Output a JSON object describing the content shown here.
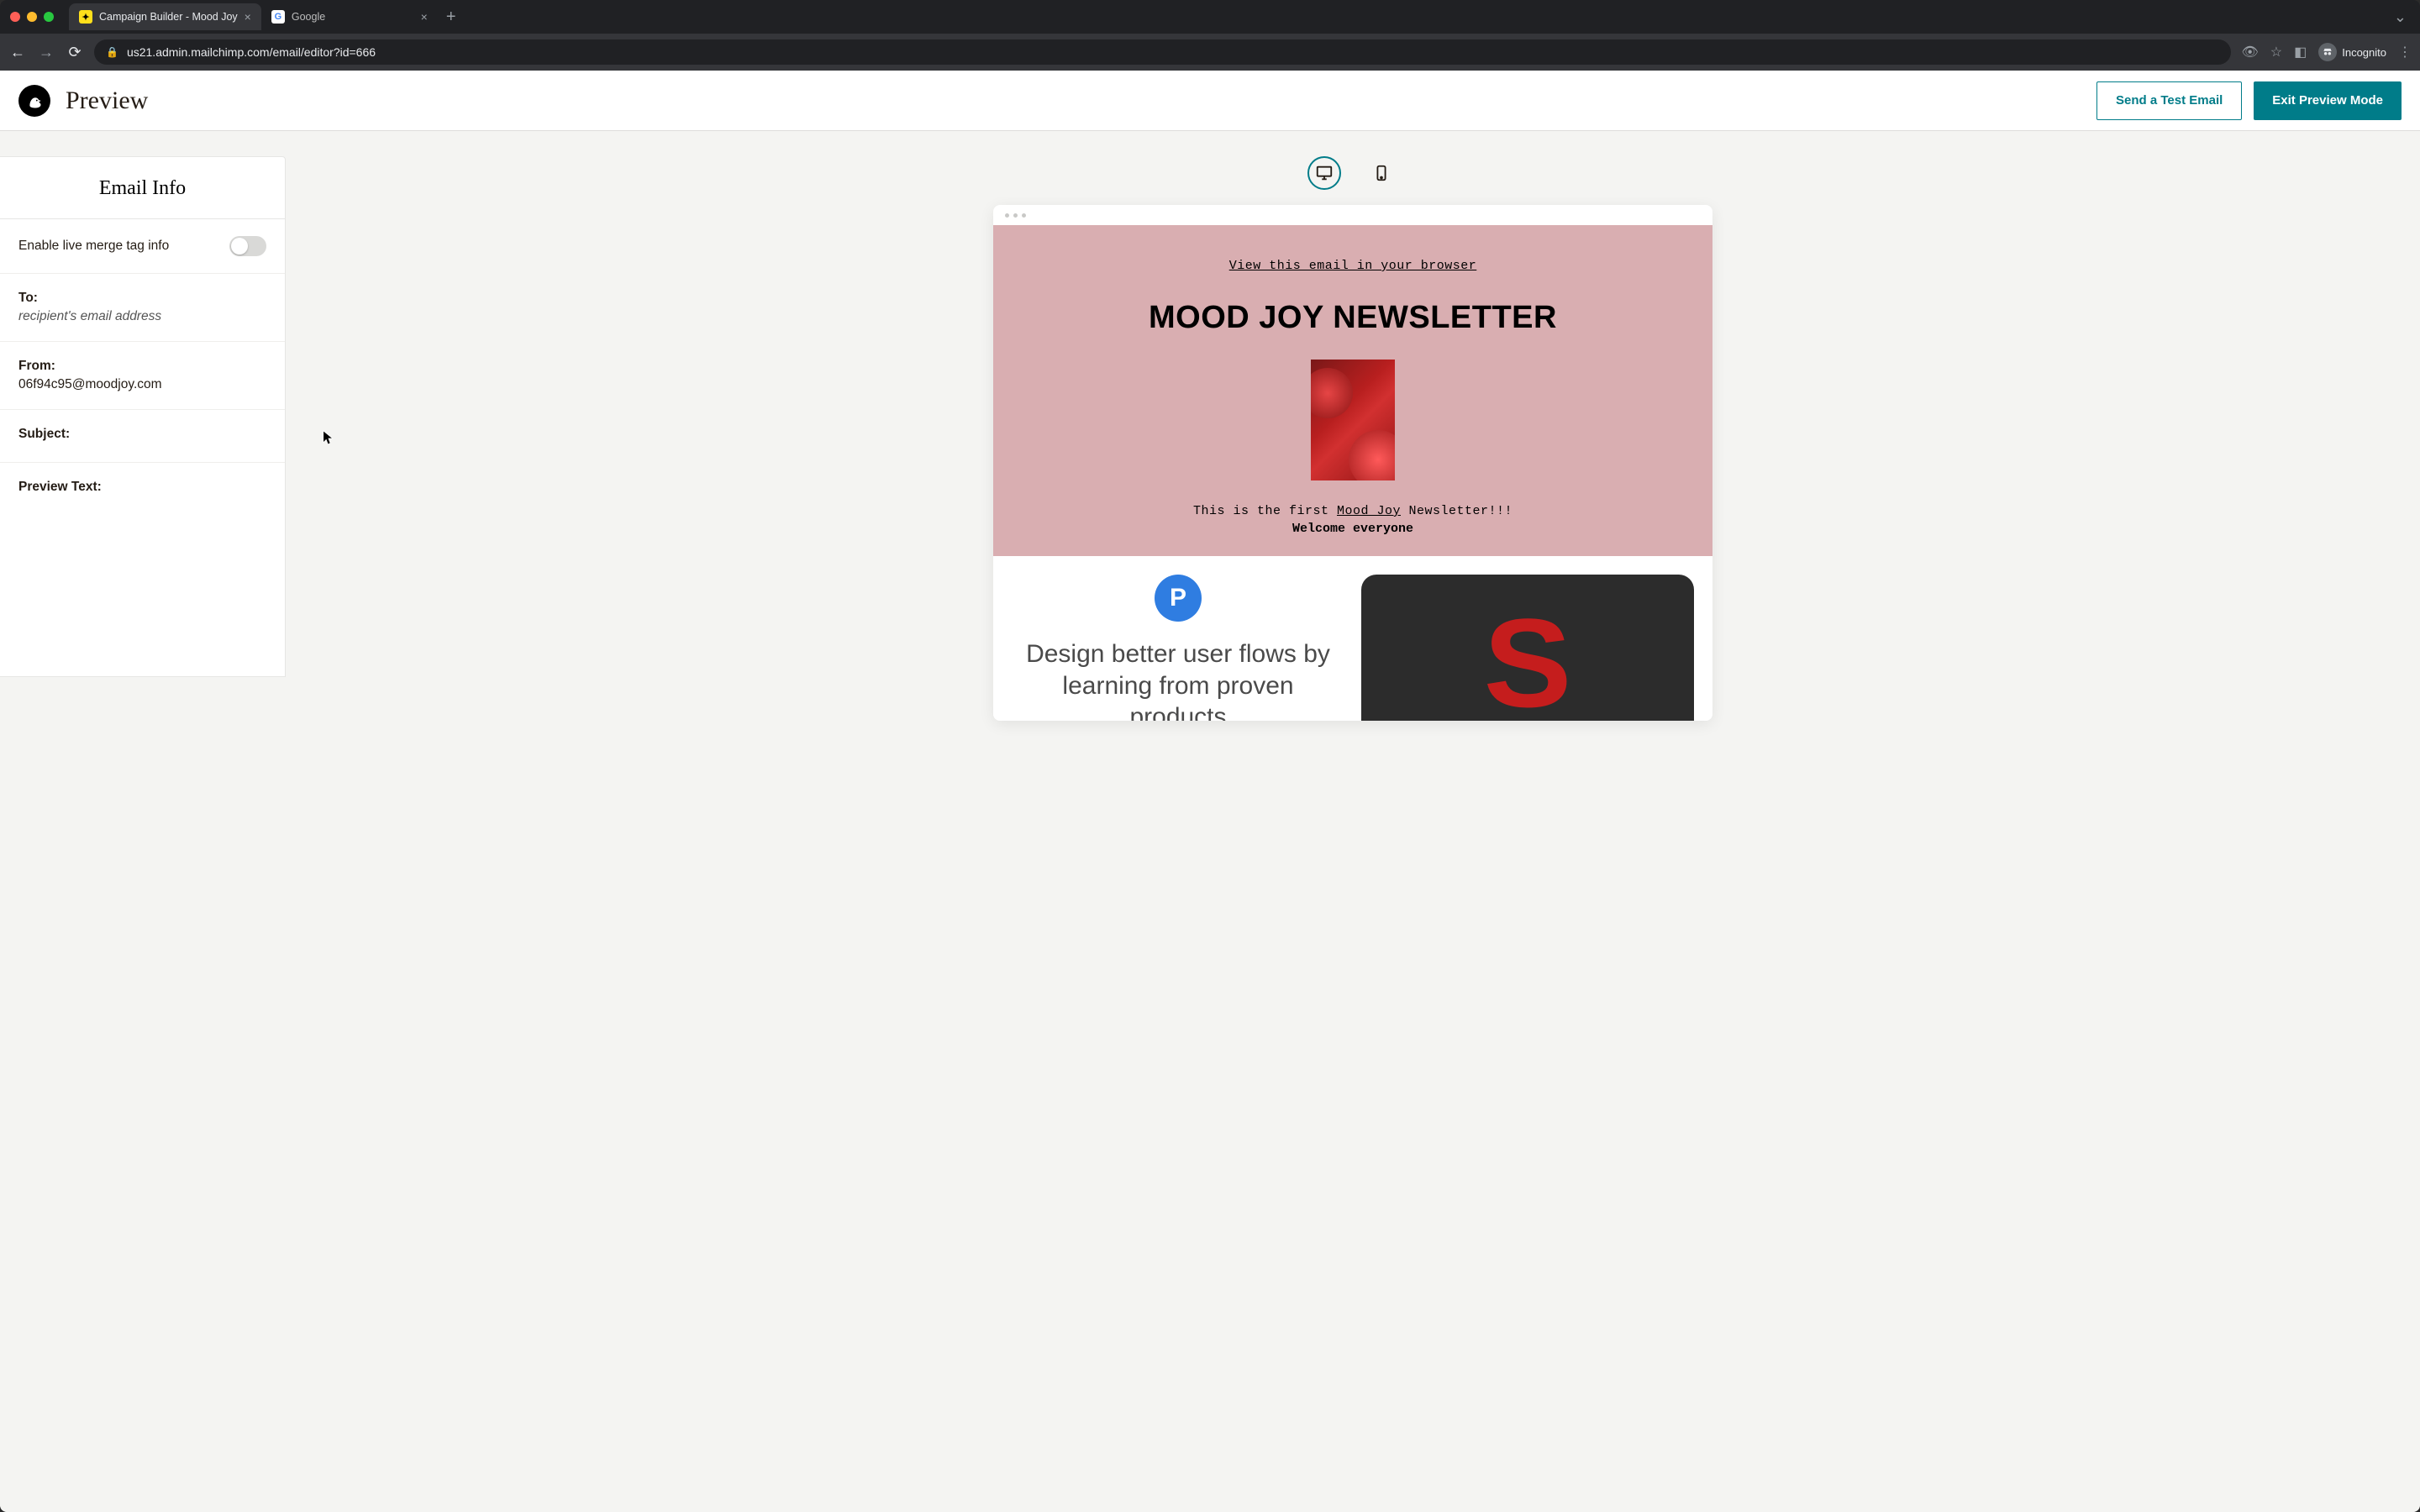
{
  "browser": {
    "tabs": [
      {
        "title": "Campaign Builder - Mood Joy",
        "active": true,
        "favicon": "mailchimp"
      },
      {
        "title": "Google",
        "active": false,
        "favicon": "google"
      }
    ],
    "url": "us21.admin.mailchimp.com/email/editor?id=666",
    "incognito_label": "Incognito"
  },
  "header": {
    "title": "Preview",
    "test_email_btn": "Send a Test Email",
    "exit_btn": "Exit Preview Mode"
  },
  "sidebar": {
    "title": "Email Info",
    "merge_toggle_label": "Enable live merge tag info",
    "merge_toggle_on": false,
    "to_label": "To:",
    "to_value": "recipient's email address",
    "from_label": "From:",
    "from_value": "06f94c95@moodjoy.com",
    "subject_label": "Subject:",
    "subject_value": "",
    "preview_text_label": "Preview Text:",
    "preview_text_value": ""
  },
  "device": {
    "active": "desktop"
  },
  "email": {
    "view_in_browser": "View this email in your browser",
    "newsletter_title": "MOOD JOY NEWSLETTER",
    "intro_prefix": "This is the first ",
    "intro_link": "Mood Joy",
    "intro_suffix": " Newsletter!!!",
    "welcome": "Welcome everyone",
    "card_p_letter": "P",
    "card_p_heading": "Design better user flows by learning from proven products",
    "card_s_letter": "S"
  }
}
